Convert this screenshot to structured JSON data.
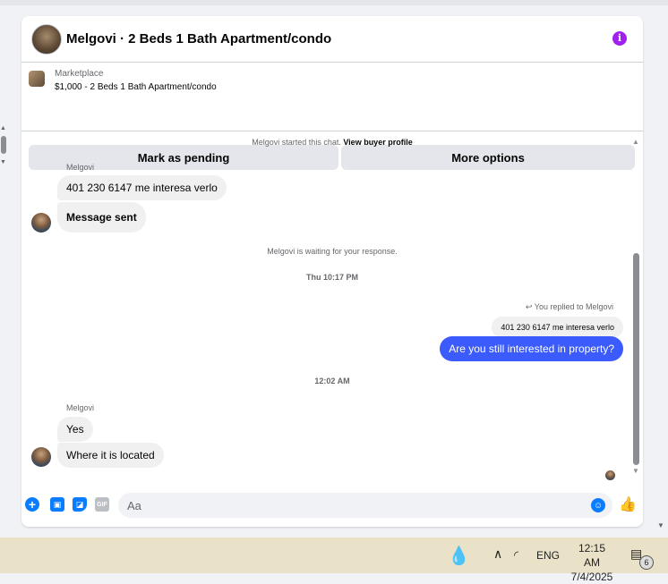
{
  "header": {
    "title": "Melgovi · 2 Beds 1 Bath Apartment/condo"
  },
  "listing": {
    "label": "Marketplace",
    "price_title": "$1,000 - 2 Beds 1 Bath Apartment/condo",
    "buttons": {
      "pending": "Mark as pending",
      "options": "More options"
    }
  },
  "conversation": {
    "started": "Melgovi started this chat.",
    "view_profile": "View buyer profile",
    "sender_name_1": "Melgovi",
    "msg1": "401 230 6147 me interesa verlo",
    "msg2": "Message sent",
    "waiting": "Melgovi is waiting for your response.",
    "time1": "Thu 10:17 PM",
    "replied_label": "You replied to Melgovi",
    "quoted": "401 230 6147 me interesa verlo",
    "outgoing": "Are you still interested in property?",
    "time2": "12:02 AM",
    "sender_name_2": "Melgovi",
    "msg3": "Yes",
    "msg4": "Where it is located"
  },
  "composer": {
    "placeholder": "Aa",
    "gif_label": "GIF"
  },
  "taskbar": {
    "lang": "ENG",
    "time": "12:15 AM",
    "date": "7/4/2025",
    "notif_count": "6"
  },
  "icons": {
    "info": "info-icon",
    "plus": "plus-icon",
    "photo": "photo-icon",
    "sticker": "sticker-icon",
    "gif": "gif-icon",
    "emoji": "emoji-icon",
    "like": "thumbs-up-icon"
  },
  "colors": {
    "accent": "#0a7cff",
    "outgoing_bubble": "#3b5bfd",
    "info": "#a020f0"
  }
}
